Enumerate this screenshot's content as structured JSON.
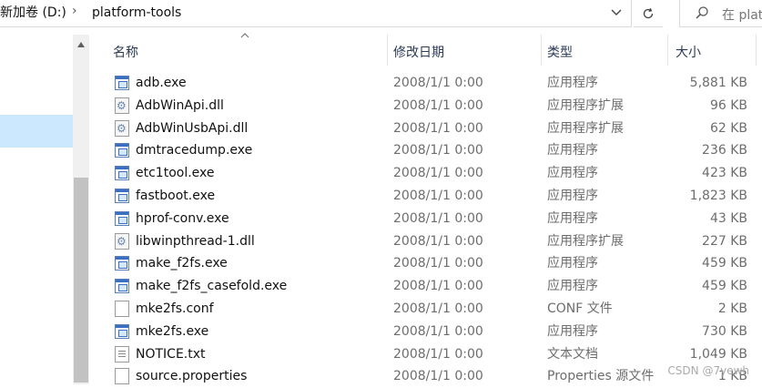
{
  "address_bar": {
    "drive_label": "新加卷 (D:)",
    "folder_label": "platform-tools"
  },
  "search": {
    "placeholder": "在 platf"
  },
  "columns": {
    "name": "名称",
    "date": "修改日期",
    "type": "类型",
    "size": "大小"
  },
  "files": [
    {
      "name": "adb.exe",
      "date": "2008/1/1 0:00",
      "type": "应用程序",
      "size": "5,881 KB",
      "icon": "exe-icon"
    },
    {
      "name": "AdbWinApi.dll",
      "date": "2008/1/1 0:00",
      "type": "应用程序扩展",
      "size": "96 KB",
      "icon": "dll-icon"
    },
    {
      "name": "AdbWinUsbApi.dll",
      "date": "2008/1/1 0:00",
      "type": "应用程序扩展",
      "size": "62 KB",
      "icon": "dll-icon"
    },
    {
      "name": "dmtracedump.exe",
      "date": "2008/1/1 0:00",
      "type": "应用程序",
      "size": "236 KB",
      "icon": "exe-icon"
    },
    {
      "name": "etc1tool.exe",
      "date": "2008/1/1 0:00",
      "type": "应用程序",
      "size": "423 KB",
      "icon": "exe-icon"
    },
    {
      "name": "fastboot.exe",
      "date": "2008/1/1 0:00",
      "type": "应用程序",
      "size": "1,823 KB",
      "icon": "exe-icon"
    },
    {
      "name": "hprof-conv.exe",
      "date": "2008/1/1 0:00",
      "type": "应用程序",
      "size": "43 KB",
      "icon": "exe-icon"
    },
    {
      "name": "libwinpthread-1.dll",
      "date": "2008/1/1 0:00",
      "type": "应用程序扩展",
      "size": "227 KB",
      "icon": "dll-icon"
    },
    {
      "name": "make_f2fs.exe",
      "date": "2008/1/1 0:00",
      "type": "应用程序",
      "size": "459 KB",
      "icon": "exe-icon"
    },
    {
      "name": "make_f2fs_casefold.exe",
      "date": "2008/1/1 0:00",
      "type": "应用程序",
      "size": "459 KB",
      "icon": "exe-icon"
    },
    {
      "name": "mke2fs.conf",
      "date": "2008/1/1 0:00",
      "type": "CONF 文件",
      "size": "2 KB",
      "icon": "file-icon"
    },
    {
      "name": "mke2fs.exe",
      "date": "2008/1/1 0:00",
      "type": "应用程序",
      "size": "730 KB",
      "icon": "exe-icon"
    },
    {
      "name": "NOTICE.txt",
      "date": "2008/1/1 0:00",
      "type": "文本文档",
      "size": "1,049 KB",
      "icon": "text-file-icon"
    },
    {
      "name": "source.properties",
      "date": "2008/1/1 0:00",
      "type": "Properties 源文件",
      "size": "1 KB",
      "icon": "file-icon"
    }
  ],
  "watermark": "CSDN @7yewh",
  "colors": {
    "nav_selected": "#cce8ff",
    "header_text": "#2b3a55",
    "secondary_text": "#6d6d6d"
  }
}
